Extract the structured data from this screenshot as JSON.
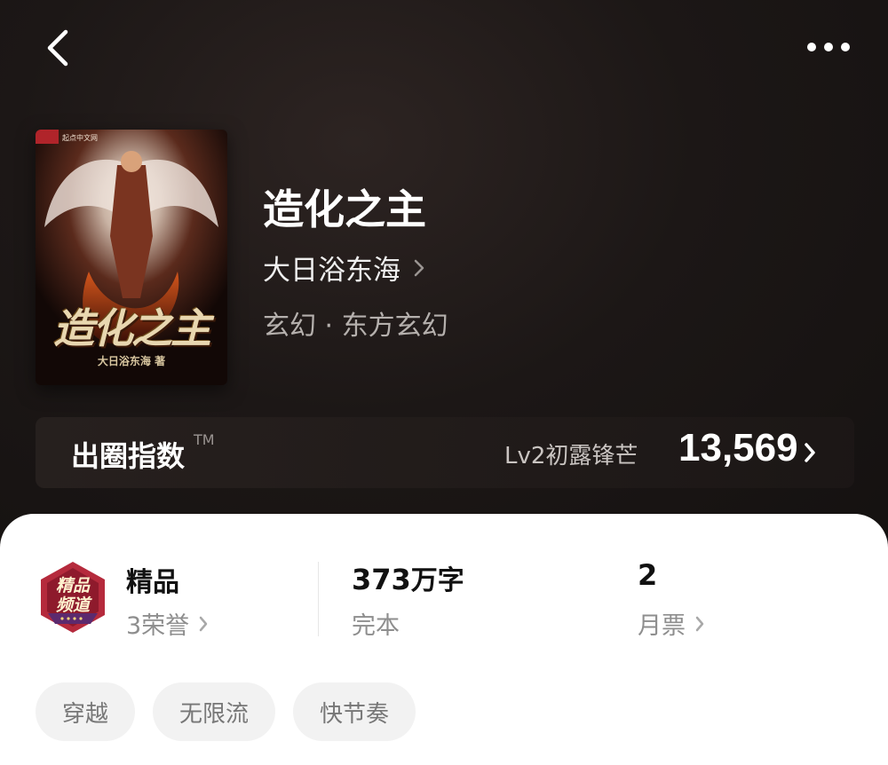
{
  "header": {
    "back_icon": "chevron-left-icon",
    "more_icon": "more-horizontal-icon"
  },
  "book": {
    "cover": {
      "publisher_badge": "起点中文网",
      "title_art": "造化之主",
      "author_art": "大日浴东海 著"
    },
    "title": "造化之主",
    "author": "大日浴东海",
    "genre": "玄幻 · 东方玄幻"
  },
  "popularity": {
    "label": "出圈指数",
    "tm": "TM",
    "level": "Lv2初露锋芒",
    "score": "13,569"
  },
  "stats": {
    "quality": {
      "medal_text_line1": "精品",
      "medal_text_line2": "频道",
      "title": "精品",
      "sub": "3荣誉"
    },
    "words": {
      "value": "373",
      "unit": "万字",
      "sub": "完本"
    },
    "tickets": {
      "value": "2",
      "sub": "月票"
    }
  },
  "tags": [
    "穿越",
    "无限流",
    "快节奏"
  ],
  "colors": {
    "hero_bg": "#1c1716",
    "panel_bg": "#ffffff",
    "tag_bg": "#f2f2f2",
    "medal_red": "#b52a3c"
  }
}
